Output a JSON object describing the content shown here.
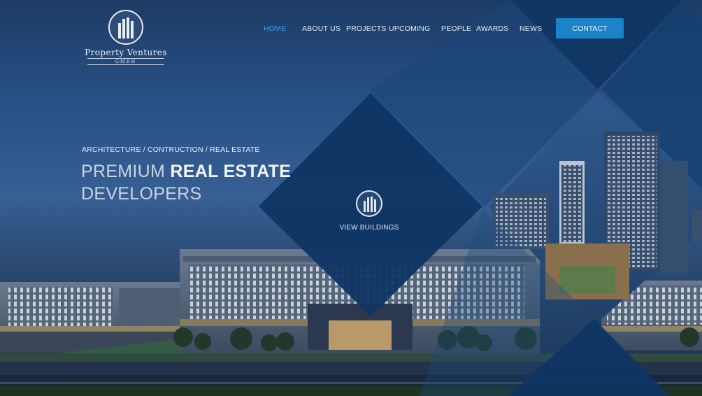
{
  "brand": {
    "name": "Property Ventures",
    "subtitle": "GMBH"
  },
  "nav": {
    "items": [
      {
        "label": "HOME",
        "active": true
      },
      {
        "label": "ABOUT US",
        "active": false
      },
      {
        "label": "PROJECTS",
        "active": false
      },
      {
        "label": "UPCOMING",
        "active": false
      },
      {
        "label": "PEOPLE",
        "active": false
      },
      {
        "label": "AWARDS",
        "active": false
      },
      {
        "label": "NEWS",
        "active": false
      }
    ],
    "contact_label": "CONTACT"
  },
  "hero": {
    "eyebrow": "ARCHITECTURE / CONTRUCTION /  REAL ESTATE",
    "headline_light": "PREMIUM ",
    "headline_bold": "REAL ESTATE",
    "headline_line2": "DEVELOPERS"
  },
  "feature": {
    "label": "VIEW BUILDINGS",
    "icon": "buildings-icon"
  },
  "colors": {
    "accent": "#1d83c8",
    "active_nav": "#3f9be6",
    "diamond": "#0f3564"
  }
}
